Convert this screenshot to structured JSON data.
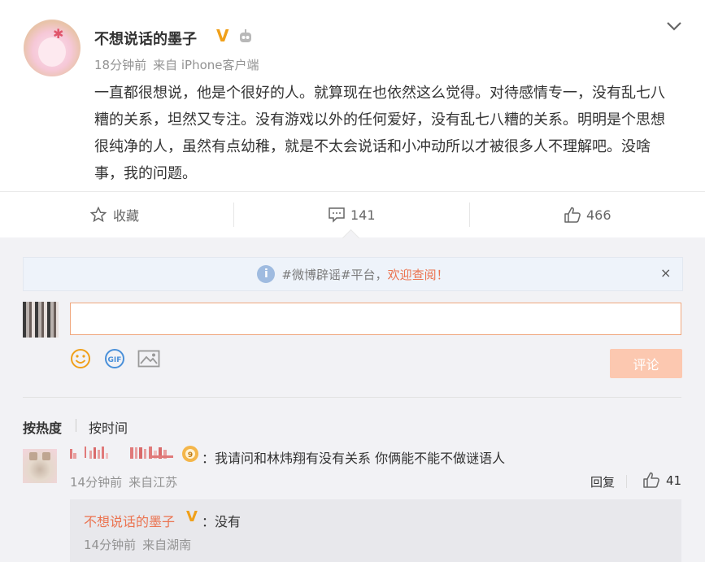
{
  "post": {
    "author": "不想说话的墨子",
    "verified_badge": "V",
    "time": "18分钟前",
    "source": "来自 iPhone客户端",
    "content": "一直都很想说，他是个很好的人。就算现在也依然这么觉得。对待感情专一，没有乱七八糟的关系，坦然又专注。没有游戏以外的任何爱好，没有乱七八糟的关系。明明是个思想很纯净的人，虽然有点幼稚，就是不太会说话和小冲动所以才被很多人不理解吧。没啥事，我的问题。",
    "icons": {
      "avatar": "user-avatar",
      "robot": "robot-icon",
      "menu": "chevron-down-icon"
    }
  },
  "actions": {
    "favorite_label": "收藏",
    "comment_count": "141",
    "like_count": "466"
  },
  "notice": {
    "tag_text": "#微博辟谣#平台，",
    "link_text": "欢迎查阅！",
    "close_label": "×"
  },
  "composer": {
    "input_value": "",
    "submit_label": "评论",
    "submit_color": "#fcc8b0"
  },
  "sort": {
    "hot_label": "按热度",
    "time_label": "按时间"
  },
  "comment": {
    "text": "：我请问和林炜翔有没有关系 你俩能不能不做谜语人",
    "time": "14分钟前",
    "location": "来自江苏",
    "reply_label": "回复",
    "like_count": "41",
    "reply": {
      "author": "不想说话的墨子",
      "verified_badge": "V",
      "text": "：没有",
      "time": "14分钟前",
      "location": "来自湖南"
    }
  },
  "colors": {
    "accent_orange": "#eb7350",
    "verified_gold": "#f0a01a",
    "meta_gray": "#939393"
  }
}
